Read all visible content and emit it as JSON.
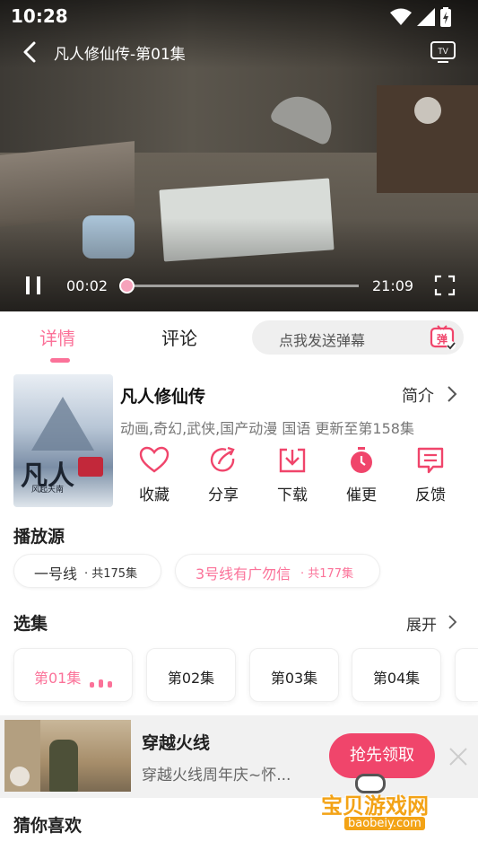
{
  "status_bar": {
    "time": "10:28"
  },
  "player": {
    "title": "凡人修仙传-第01集",
    "current_time": "00:02",
    "total_time": "21:09",
    "progress_fraction": 0.002
  },
  "tabs": {
    "details": "详情",
    "comments": "评论"
  },
  "danmaku": {
    "placeholder": "点我发送弹幕",
    "icon_text": "弹"
  },
  "show": {
    "title": "凡人修仙传",
    "intro_label": "简介",
    "meta": "动画,奇幻,武侠,国产动漫 国语 更新至第158集",
    "cover_text": "凡人",
    "cover_sub": "风起天南"
  },
  "actions": [
    {
      "label": "收藏",
      "icon": "heart-icon"
    },
    {
      "label": "分享",
      "icon": "share-icon"
    },
    {
      "label": "下载",
      "icon": "download-icon"
    },
    {
      "label": "催更",
      "icon": "timer-icon"
    },
    {
      "label": "反馈",
      "icon": "feedback-icon"
    }
  ],
  "sources": {
    "title": "播放源",
    "items": [
      {
        "name": "一号线",
        "count": " · 共175集"
      },
      {
        "name": "3号线有广勿信",
        "count": " · 共177集"
      }
    ]
  },
  "episodes": {
    "title": "选集",
    "expand_label": "展开",
    "items": [
      "第01集",
      "第02集",
      "第03集",
      "第04集"
    ]
  },
  "ad": {
    "title": "穿越火线",
    "desc": "穿越火线周年庆~怀...",
    "cta": "抢先领取"
  },
  "guess": {
    "title": "猜你喜欢"
  },
  "watermark": {
    "text": "宝贝游戏网",
    "url": "baobeiy.com"
  },
  "colors": {
    "accent": "#fb7299",
    "ad_button": "#f0456b"
  }
}
